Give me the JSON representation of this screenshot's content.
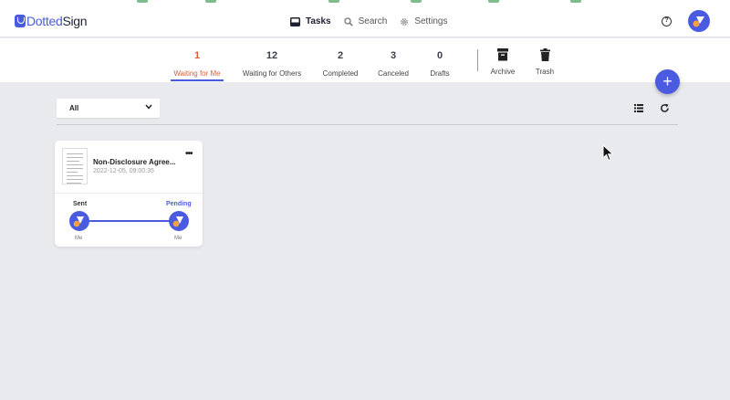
{
  "brand": {
    "name_prefix": "",
    "name_highlight": "Dotted",
    "name_suffix": "Sign"
  },
  "nav": [
    {
      "label": "Tasks",
      "icon": "inbox-icon",
      "active": true
    },
    {
      "label": "Search",
      "icon": "search-icon",
      "active": false
    },
    {
      "label": "Settings",
      "icon": "gear-icon",
      "active": false
    }
  ],
  "help": {
    "glyph": "?"
  },
  "status_tabs": [
    {
      "count": "1",
      "label": "Waiting for Me",
      "active": true
    },
    {
      "count": "12",
      "label": "Waiting for Others",
      "active": false
    },
    {
      "count": "2",
      "label": "Completed",
      "active": false
    },
    {
      "count": "3",
      "label": "Canceled",
      "active": false
    },
    {
      "count": "0",
      "label": "Drafts",
      "active": false
    },
    {
      "label": "Archive",
      "icon": "archive-icon"
    },
    {
      "label": "Trash",
      "icon": "trash-icon"
    }
  ],
  "fab": {
    "glyph": "+"
  },
  "filter": {
    "value": "All"
  },
  "card": {
    "title": "Non-Disclosure Agree...",
    "date": "2022-12-05, 09:00:35",
    "more": "•••",
    "sender_status": "Sent",
    "receiver_status": "Pending",
    "sender_name": "Me",
    "receiver_name": "Me"
  },
  "colors": {
    "accent": "#4a5be0",
    "active_tab": "#d6603b",
    "background": "#e9eaee",
    "avatar_dot": "#f4a340"
  }
}
